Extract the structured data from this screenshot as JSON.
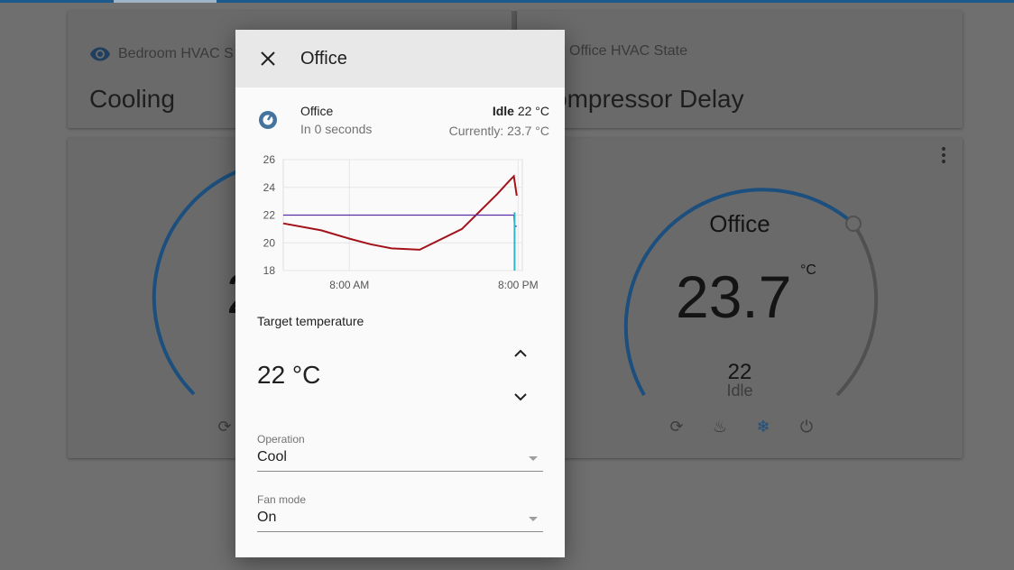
{
  "background_cards": {
    "left_state_card": {
      "title": "Bedroom HVAC S",
      "state": "Cooling"
    },
    "right_state_card": {
      "title": "Office HVAC State",
      "state": "ompressor Delay"
    },
    "left_thermostat": {
      "value_partial": "2"
    },
    "right_thermostat": {
      "name": "Office",
      "current_temp": "23.7",
      "unit": "°C",
      "target": "22",
      "status": "Idle"
    }
  },
  "dialog": {
    "title": "Office",
    "entity": {
      "name": "Office",
      "last_changed": "In 0 seconds",
      "state": "Idle",
      "target_inline": "22 °C",
      "current": "Currently: 23.7 °C"
    },
    "target_temperature": {
      "label": "Target temperature",
      "value": "22 °C"
    },
    "operation": {
      "label": "Operation",
      "value": "Cool"
    },
    "fan_mode": {
      "label": "Fan mode",
      "value": "On"
    }
  },
  "chart_data": {
    "type": "line",
    "y_ticks": [
      "26",
      "24",
      "22",
      "20",
      "18"
    ],
    "ylim": [
      18,
      26
    ],
    "x_ticks": [
      "8:00 AM",
      "8:00 PM"
    ],
    "series": [
      {
        "color": "#a3121a",
        "x_hours": [
          -4.7,
          -2,
          0,
          1.5,
          3,
          5,
          8,
          10.5,
          11.4,
          11.7,
          11.9
        ],
        "values": [
          21.4,
          20.9,
          20.3,
          19.9,
          19.6,
          19.5,
          21.0,
          23.5,
          24.5,
          24.8,
          23.4
        ]
      },
      {
        "color": "#5b2ea6",
        "x_hours": [
          -4.7,
          11.7,
          11.75,
          11.9
        ],
        "values": [
          22.0,
          22.0,
          21.2,
          21.2
        ]
      }
    ],
    "colors": {
      "accent": "#1c5a8e",
      "cool_series": "#a3121a",
      "target_series": "#5b2ea6"
    }
  }
}
